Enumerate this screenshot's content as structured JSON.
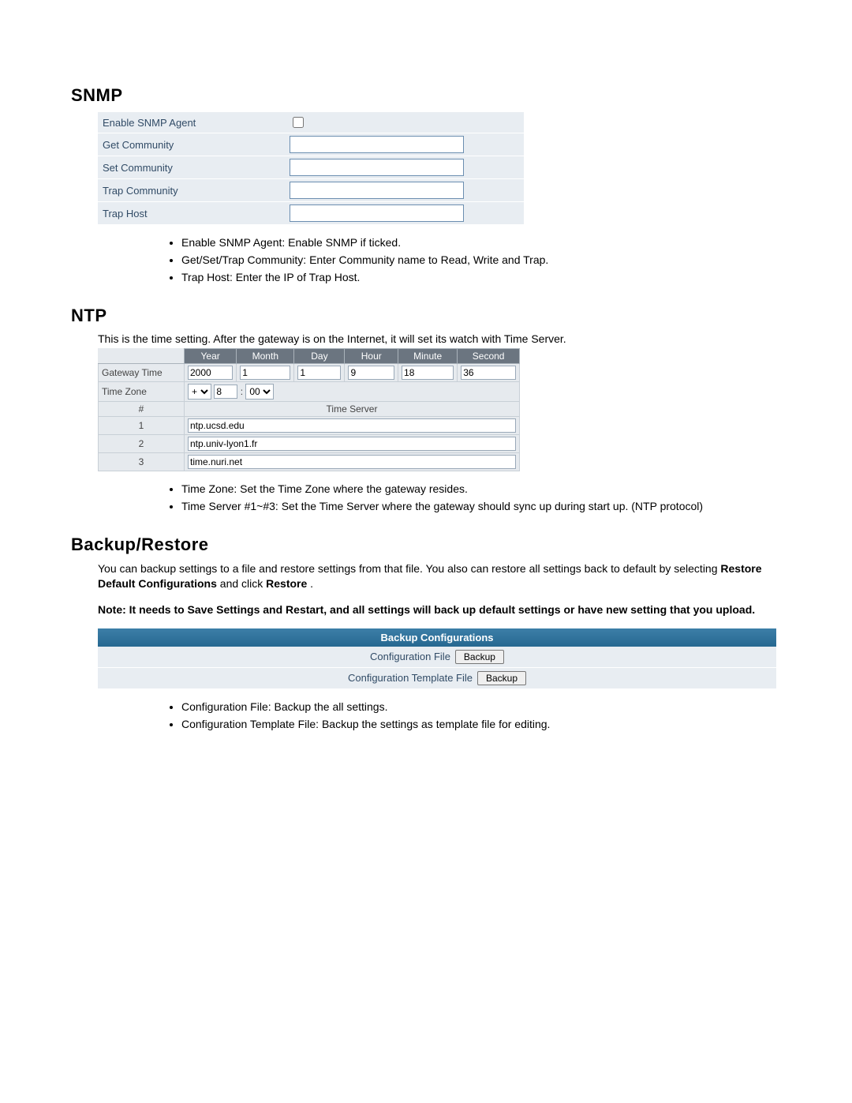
{
  "snmp": {
    "title": "SNMP",
    "rows": {
      "enable_label": "Enable SNMP Agent",
      "get_label": "Get Community",
      "set_label": "Set Community",
      "trap_comm_label": "Trap Community",
      "trap_host_label": "Trap Host"
    },
    "bullets": [
      "Enable SNMP Agent: Enable SNMP if ticked.",
      "Get/Set/Trap Community: Enter Community name to Read, Write and Trap.",
      "Trap Host: Enter the IP of Trap Host."
    ]
  },
  "ntp": {
    "title": "NTP",
    "description": "This is the time setting. After the gateway is on the Internet, it will set its watch with Time Server.",
    "headers": {
      "year": "Year",
      "month": "Month",
      "day": "Day",
      "hour": "Hour",
      "minute": "Minute",
      "second": "Second"
    },
    "gateway_time_label": "Gateway Time",
    "gateway_time": {
      "year": "2000",
      "month": "1",
      "day": "1",
      "hour": "9",
      "minute": "18",
      "second": "36"
    },
    "timezone_label": "Time Zone",
    "timezone": {
      "sign": "+",
      "hours": "8",
      "sep": ":",
      "minutes": "00"
    },
    "num_col": "#",
    "time_server_header": "Time Server",
    "servers": [
      {
        "n": "1",
        "host": "ntp.ucsd.edu"
      },
      {
        "n": "2",
        "host": "ntp.univ-lyon1.fr"
      },
      {
        "n": "3",
        "host": "time.nuri.net"
      }
    ],
    "bullets": [
      "Time Zone: Set the Time Zone where the gateway resides.",
      "Time Server #1~#3: Set the Time Server where the gateway should sync up during start up. (NTP protocol)"
    ]
  },
  "backup": {
    "title": "Backup/Restore",
    "text_before": "You can backup settings to a file and restore settings from that file. You also can restore all settings back to default by selecting ",
    "text_bold1": "Restore Default Configurations",
    "text_mid": " and click ",
    "text_bold2": "Restore",
    "text_after": ".",
    "note": "Note: It needs to Save Settings and Restart, and all settings will back up default settings or have new setting that you upload.",
    "table_header": "Backup Configurations",
    "row1_label": "Configuration File",
    "row2_label": "Configuration Template File",
    "button_label": "Backup",
    "bullets": [
      "Configuration File: Backup the all settings.",
      "Configuration Template File: Backup the settings as template file for editing."
    ]
  }
}
